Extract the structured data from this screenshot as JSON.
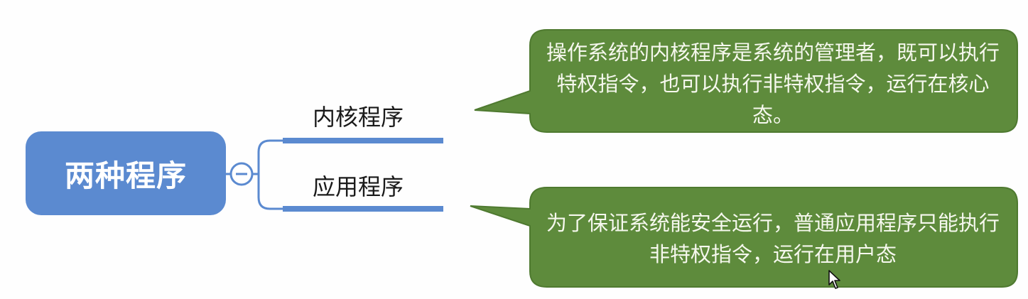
{
  "root": {
    "label": "两种程序",
    "collapse_symbol": "−"
  },
  "branches": [
    {
      "label": "内核程序"
    },
    {
      "label": "应用程序"
    }
  ],
  "callouts": [
    {
      "text": "操作系统的内核程序是系统的管理者，既可以执行特权指令，也可以执行非特权指令，运行在核心态。"
    },
    {
      "text": "为了保证系统能安全运行，普通应用程序只能执行非特权指令，运行在用户态"
    }
  ],
  "colors": {
    "root_fill": "#5b8ad0",
    "connector": "#5b8ad0",
    "callout_fill": "#5e8b3c",
    "callout_text": "#f6f8ee"
  },
  "icons": {
    "collapse": "minus-circle-icon",
    "cursor": "mouse-pointer-icon"
  }
}
